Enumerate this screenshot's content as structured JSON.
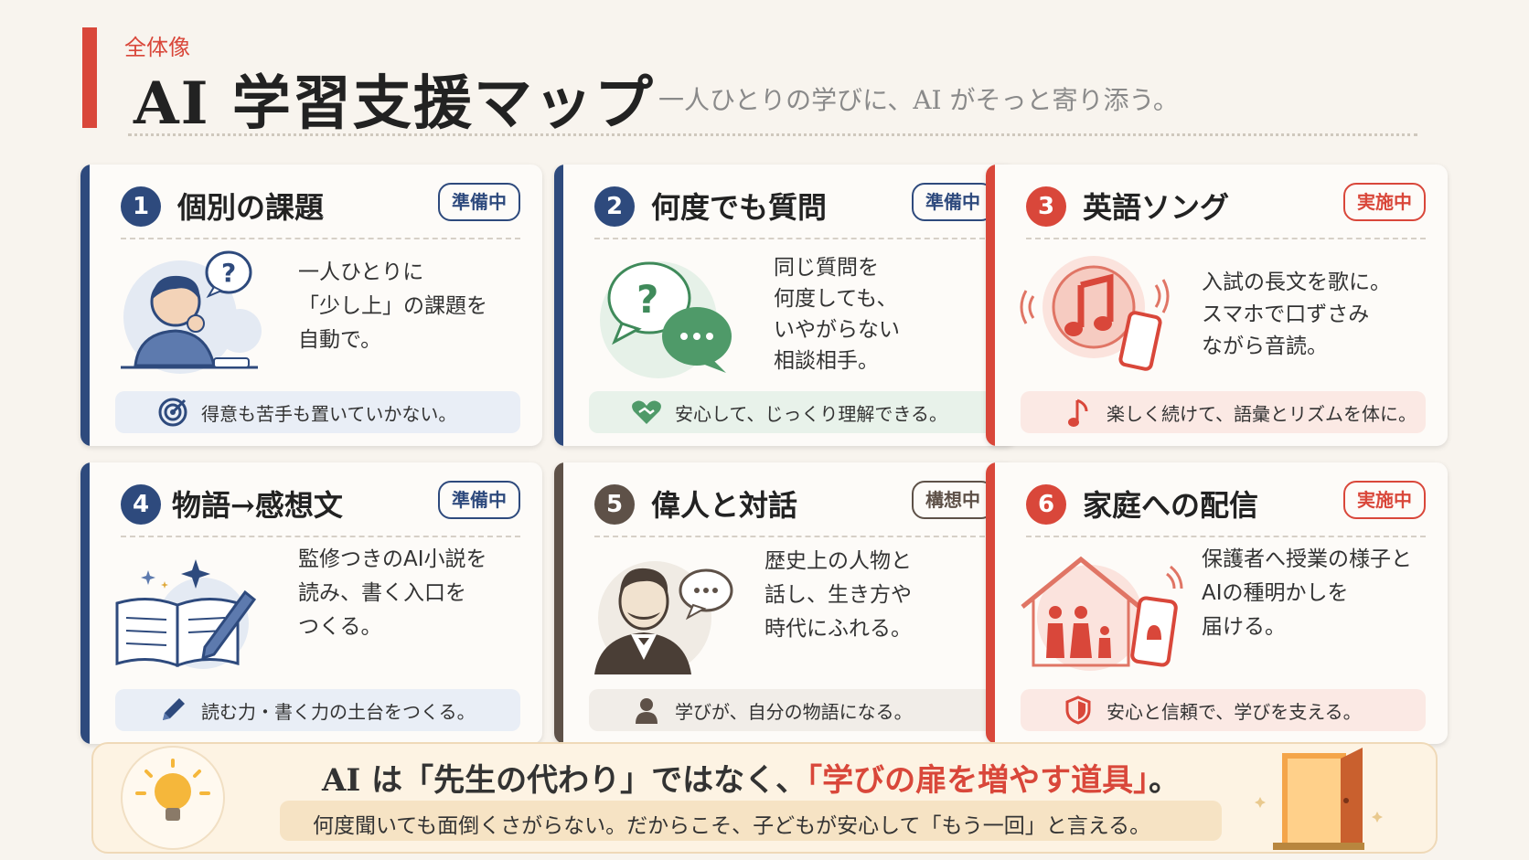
{
  "header": {
    "kicker": "全体像",
    "title": "AI 学習支援マップ",
    "subtitle": "一人ひとりの学びに、AI がそっと寄り添う。"
  },
  "cards": [
    {
      "num": "1",
      "title": "個別の課題",
      "status": "準備中",
      "text": "一人ひとりに\n「少し上」の課題を\n自動で。",
      "footer": "得意も苦手も置いていかない。",
      "icon": "student-thinking-icon",
      "footer_icon": "target-icon"
    },
    {
      "num": "2",
      "title": "何度でも質問",
      "status": "準備中",
      "text": "同じ質問を\n何度しても、\nいやがらない\n相談相手。",
      "footer": "安心して、じっくり理解できる。",
      "icon": "chat-bubbles-icon",
      "footer_icon": "heart-handshake-icon"
    },
    {
      "num": "3",
      "title": "英語ソング",
      "status": "実施中",
      "text": "入試の長文を歌に。\nスマホで口ずさみ\nながら音読。",
      "footer": "楽しく続けて、語彙とリズムを体に。",
      "icon": "music-phone-icon",
      "footer_icon": "music-note-icon"
    },
    {
      "num": "4",
      "title": "物語→感想文",
      "status": "準備中",
      "text": "監修つきのAI小説を\n読み、書く入口を\nつくる。",
      "footer": "読む力・書く力の土台をつくる。",
      "icon": "book-pen-icon",
      "footer_icon": "pencil-icon"
    },
    {
      "num": "5",
      "title": "偉人と対話",
      "status": "構想中",
      "text": "歴史上の人物と\n話し、生き方や\n時代にふれる。",
      "footer": "学びが、自分の物語になる。",
      "icon": "historical-figure-icon",
      "footer_icon": "person-icon"
    },
    {
      "num": "6",
      "title": "家庭への配信",
      "status": "実施中",
      "text": "保護者へ授業の様子と\nAIの種明かしを\n届ける。",
      "footer": "安心と信頼で、学びを支える。",
      "icon": "home-family-phone-icon",
      "footer_icon": "shield-icon"
    }
  ],
  "bottom": {
    "msg_part1": "AI は「先生の代わり」ではなく、",
    "msg_highlight": "「学びの扉を増やす道具」",
    "msg_part2": "。",
    "sub": "何度聞いても面倒くさがらない。だからこそ、子どもが安心して「もう一回」と言える。"
  },
  "colors": {
    "accent_red": "#d9473a",
    "navy": "#2e4a7d",
    "brown": "#5e5148",
    "background": "#f8f4ee"
  }
}
